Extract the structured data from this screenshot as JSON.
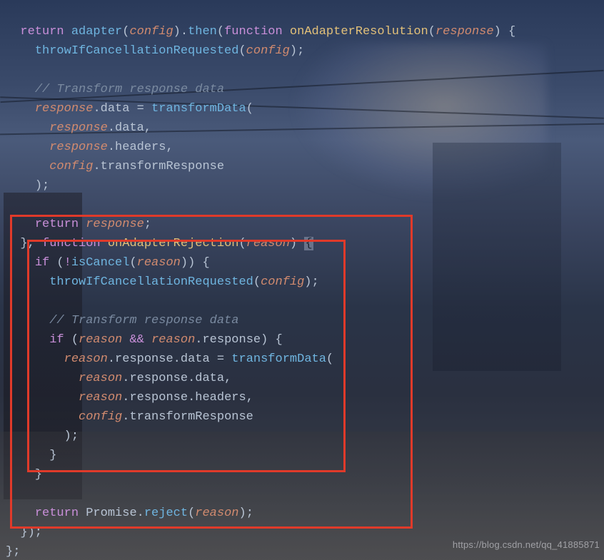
{
  "watermark": "https://blog.csdn.net/qq_41885871",
  "code": {
    "l1": {
      "return": "return",
      "adapter": "adapter",
      "config": "config",
      "then": "then",
      "func": "function",
      "onRes": "onAdapterResolution",
      "response": "response"
    },
    "l2": {
      "throw": "throwIfCancellationRequested",
      "config": "config"
    },
    "l4": {
      "cmt": "// Transform response data"
    },
    "l5": {
      "response": "response",
      "data": "data",
      "transform": "transformData"
    },
    "l6": {
      "response": "response",
      "data": "data"
    },
    "l7": {
      "response": "response",
      "headers": "headers"
    },
    "l8": {
      "config": "config",
      "tr": "transformResponse"
    },
    "l11": {
      "return": "return",
      "response": "response"
    },
    "l12": {
      "func": "function",
      "onRej": "onAdapterRejection",
      "reason": "reason"
    },
    "l13": {
      "if": "if",
      "isCancel": "isCancel",
      "reason": "reason"
    },
    "l14": {
      "throw": "throwIfCancellationRequested",
      "config": "config"
    },
    "l16": {
      "cmt": "// Transform response data"
    },
    "l17": {
      "if": "if",
      "reason": "reason",
      "and": "&&",
      "response": "response"
    },
    "l18": {
      "reason": "reason",
      "response": "response",
      "data": "data",
      "transform": "transformData"
    },
    "l19": {
      "reason": "reason",
      "response": "response",
      "data": "data"
    },
    "l20": {
      "reason": "reason",
      "response": "response",
      "headers": "headers"
    },
    "l21": {
      "config": "config",
      "tr": "transformResponse"
    },
    "l26": {
      "return": "return",
      "promise": "Promise",
      "reject": "reject",
      "reason": "reason"
    }
  }
}
